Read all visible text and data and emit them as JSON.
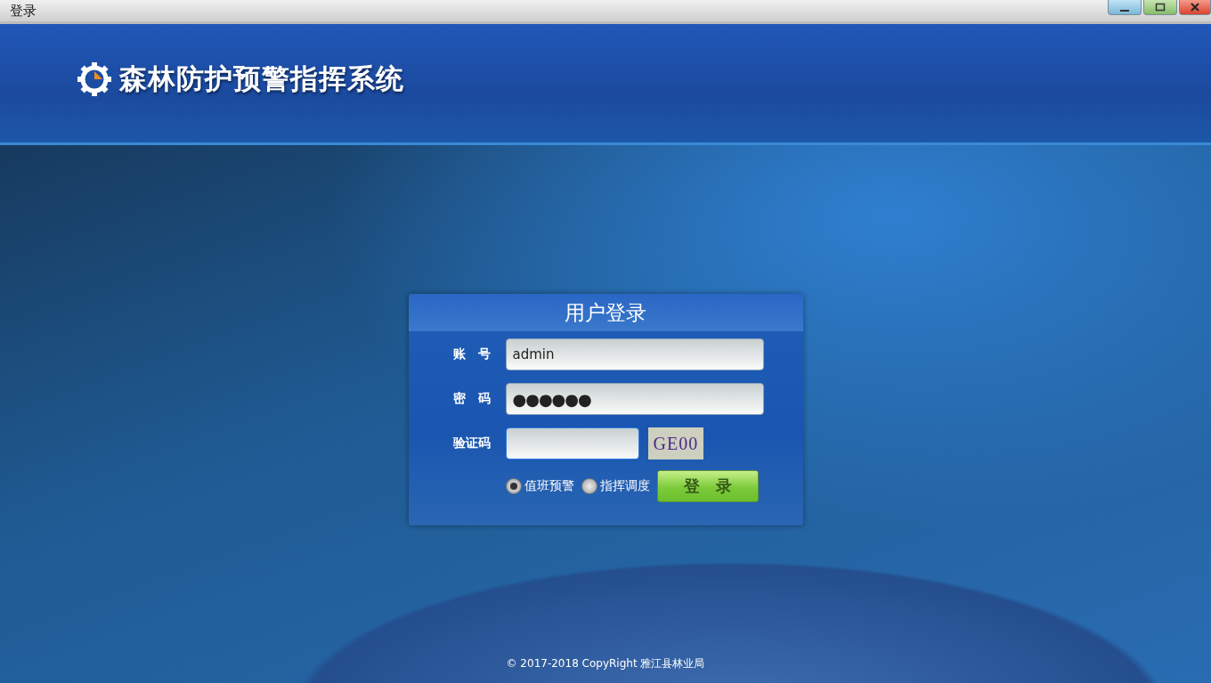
{
  "window": {
    "title": "登录"
  },
  "header": {
    "system_name": "森林防护预警指挥系统"
  },
  "login": {
    "title": "用户登录",
    "fields": [
      {
        "kind": "text",
        "label": "账　号",
        "value": "admin"
      },
      {
        "kind": "password",
        "label": "密　码",
        "value": "●●●●●●"
      },
      {
        "kind": "captcha",
        "label": "验证码",
        "captcha": "GE00"
      }
    ],
    "modes": [
      {
        "label": "值班预警",
        "selected": true
      },
      {
        "label": "指挥调度",
        "selected": false
      }
    ],
    "submit": "登　录"
  },
  "footer": {
    "copyright": "© 2017-2018  CopyRight 雅江县林业局"
  }
}
